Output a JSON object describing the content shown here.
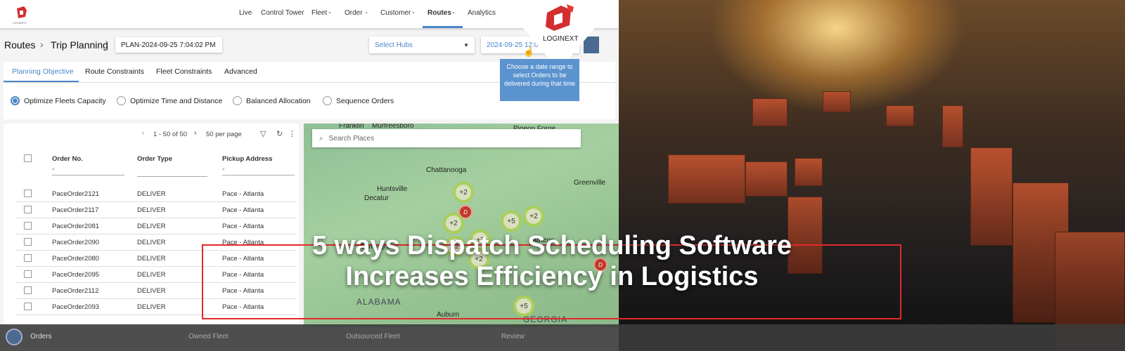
{
  "brand": {
    "name": "LOGINEXT",
    "small_name": "LOGINEXT",
    "accent": "#e02a2a",
    "ui_blue": "#4a86c8"
  },
  "nav": {
    "items": [
      "Live",
      "Control Tower",
      "Fleet",
      "Order",
      "Customer",
      "Routes",
      "Analytics"
    ],
    "active": "Routes"
  },
  "breadcrumb": {
    "root": "Routes",
    "current": "Trip Planning",
    "plan": "PLAN-2024-09-25 7:04:02 PM"
  },
  "filters": {
    "hubs_placeholder": "Select Hubs",
    "date_value": "2024-09-25 12:00"
  },
  "tooltip": "Choose a date range to select Orders to be delivered during that time",
  "tabs": [
    "Planning Objective",
    "Route Constraints",
    "Fleet Constraints",
    "Advanced"
  ],
  "objectives": [
    {
      "label": "Optimize Fleets Capacity",
      "selected": true
    },
    {
      "label": "Optimize Time and Distance",
      "selected": false
    },
    {
      "label": "Balanced Allocation",
      "selected": false
    },
    {
      "label": "Sequence Orders",
      "selected": false
    }
  ],
  "pagination": {
    "range": "1 - 50 of 50",
    "per_page": "50 per page"
  },
  "table": {
    "columns": [
      "Order No.",
      "Order Type",
      "Pickup Address"
    ],
    "rows": [
      [
        "PaceOrder2121",
        "DELIVER",
        "Pace - Atlanta"
      ],
      [
        "PaceOrder2117",
        "DELIVER",
        "Pace - Atlanta"
      ],
      [
        "PaceOrder2081",
        "DELIVER",
        "Pace - Atlanta"
      ],
      [
        "PaceOrder2090",
        "DELIVER",
        "Pace - Atlanta"
      ],
      [
        "PaceOrder2080",
        "DELIVER",
        "Pace - Atlanta"
      ],
      [
        "PaceOrder2095",
        "DELIVER",
        "Pace - Atlanta"
      ],
      [
        "PaceOrder2112",
        "DELIVER",
        "Pace - Atlanta"
      ],
      [
        "PaceOrder2093",
        "DELIVER",
        "Pace - Atlanta"
      ]
    ]
  },
  "map": {
    "search_placeholder": "Search Places",
    "cities": [
      "Franklin",
      "Murfreesboro",
      "Pigeon Forge",
      "Chattanooga",
      "Huntsville",
      "Decatur",
      "Greenville",
      "Birmingham",
      "Athens",
      "Auburn"
    ],
    "states": [
      "ALABAMA",
      "GEORGIA"
    ],
    "markers": [
      "+2",
      "D",
      "+2",
      "+5",
      "+2",
      "+7",
      "+2",
      "+2",
      "D",
      "+5"
    ]
  },
  "bottom_steps": [
    "Orders",
    "Owned Fleet",
    "Outsourced Fleet",
    "Review"
  ],
  "headline": {
    "line1": "5 ways Dispatch Scheduling Software",
    "line2": "Increases Efficiency in Logistics"
  }
}
